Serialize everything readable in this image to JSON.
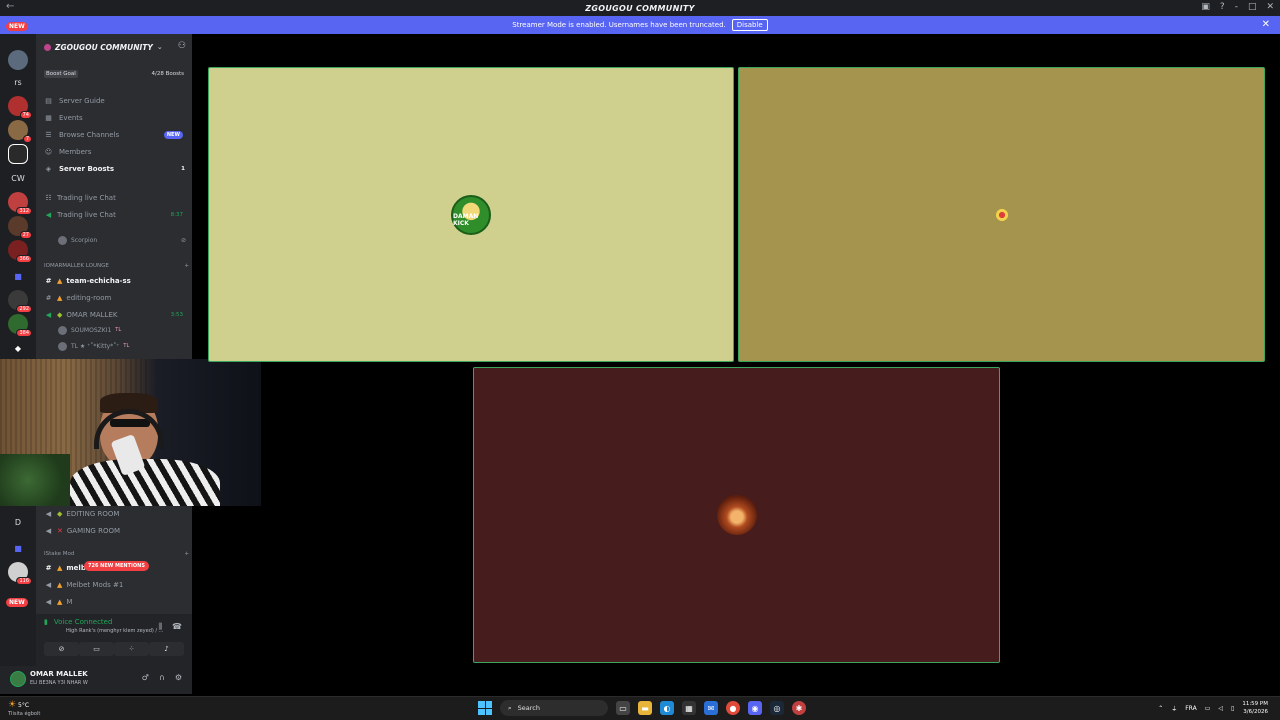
{
  "window": {
    "title": "ZGOUGOU COMMUNITY",
    "controls": [
      "-",
      "□",
      "✕"
    ]
  },
  "banner": {
    "text": "Streamer Mode is enabled. Usernames have been truncated.",
    "button": "Disable"
  },
  "rail": {
    "new_top": "NEW",
    "new_bottom": "NEW",
    "servers": [
      {
        "label": "rs",
        "badge": ""
      },
      {
        "label": "",
        "badge": "74"
      },
      {
        "label": "",
        "badge": "7"
      },
      {
        "label": "CW",
        "badge": ""
      },
      {
        "label": "",
        "badge": "312"
      },
      {
        "label": "",
        "badge": "27"
      },
      {
        "label": "",
        "badge": "366"
      },
      {
        "label": "",
        "badge": "292"
      },
      {
        "label": "",
        "badge": "384"
      },
      {
        "label": "D",
        "badge": ""
      },
      {
        "label": "",
        "badge": "116"
      }
    ]
  },
  "sidebar": {
    "server_name": "ZGOUGOU COMMUNITY",
    "boost_goal": "Boost Goal",
    "boost_count": "4/28 Boosts",
    "nav": [
      {
        "label": "Server Guide",
        "icon": "guide-icon"
      },
      {
        "label": "Events",
        "icon": "calendar-icon"
      },
      {
        "label": "Browse Channels",
        "icon": "browse-icon",
        "badge": "NEW"
      },
      {
        "label": "Members",
        "icon": "members-icon"
      },
      {
        "label": "Server Boosts",
        "icon": "boost-icon",
        "count": "1"
      }
    ],
    "channels_a": [
      {
        "label": "Trading live Chat",
        "type": "text",
        "time": ""
      },
      {
        "label": "Trading live Chat",
        "type": "voice",
        "time": "8:37"
      }
    ],
    "voice_user_1": "Scorpion",
    "category_1": "IOMARMALLEK LOUNGE",
    "channels_b": [
      {
        "label": "team-echicha-ss",
        "type": "text",
        "bright": true
      },
      {
        "label": "editing-room",
        "type": "text",
        "bright": false
      },
      {
        "label": "OMAR MALLEK",
        "type": "voice",
        "time": "3:53"
      }
    ],
    "voice_users": [
      "SOUMOSZKI1",
      "TL ★ ⁺˚*Kitty*˚⁺"
    ],
    "user_tag": "TL",
    "channels_c": [
      {
        "label": "EDITING ROOM",
        "type": "voice"
      },
      {
        "label": "GAMING ROOM",
        "type": "voice"
      }
    ],
    "category_2": "IStake Mod",
    "channels_d": [
      {
        "label": "melbet-mods",
        "type": "text",
        "bright": true
      },
      {
        "label": "Melbet Mods #1",
        "type": "voice",
        "bright": false
      },
      {
        "label": "M",
        "type": "voice",
        "bright": false
      }
    ],
    "mentions": "726 NEW MENTIONS"
  },
  "voice": {
    "status": "Voice Connected",
    "channel": "High Rank's (menghyr klem zeyed) / ..."
  },
  "user": {
    "name": "OMAR MALLEK",
    "status": "ELI BE3NA Y3I NHAR W"
  },
  "tiles": [
    {
      "name": "DAMAN KICK",
      "bg": "#cfcf8e"
    },
    {
      "name": "",
      "bg": "#a4944e"
    },
    {
      "name": "",
      "bg": "#461c1c"
    }
  ],
  "taskbar": {
    "weather_temp": "5°C",
    "weather_desc": "Tlisita égbolt",
    "search": "Search",
    "lang": "FRA",
    "time": "11:59 PM",
    "date": "3/6/2026"
  }
}
